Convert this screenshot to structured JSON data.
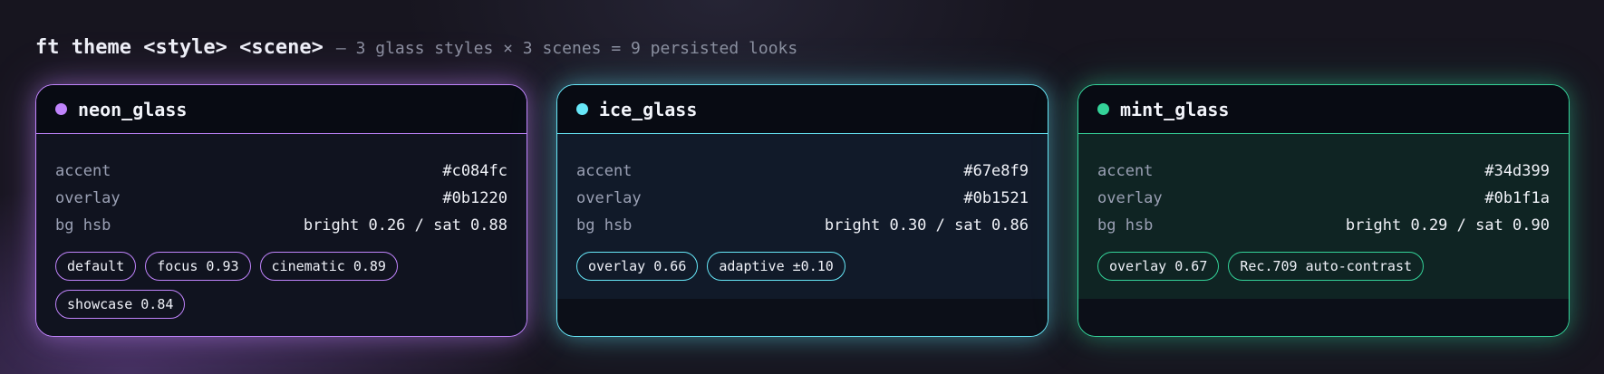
{
  "header": {
    "command": "ft theme <style> <scene>",
    "subtitle": "— 3 glass styles × 3 scenes = 9 persisted looks"
  },
  "cards": [
    {
      "name": "neon_glass",
      "color": "#c084fc",
      "rows": [
        {
          "key": "accent",
          "value": "#c084fc"
        },
        {
          "key": "overlay",
          "value": "#0b1220"
        },
        {
          "key": "bg hsb",
          "value": "bright 0.26 / sat 0.88"
        }
      ],
      "chips": [
        "default",
        "focus 0.93",
        "cinematic 0.89",
        "showcase 0.84"
      ]
    },
    {
      "name": "ice_glass",
      "color": "#67e8f9",
      "rows": [
        {
          "key": "accent",
          "value": "#67e8f9"
        },
        {
          "key": "overlay",
          "value": "#0b1521"
        },
        {
          "key": "bg hsb",
          "value": "bright 0.30 / sat 0.86"
        }
      ],
      "chips": [
        "overlay 0.66",
        "adaptive ±0.10"
      ]
    },
    {
      "name": "mint_glass",
      "color": "#34d399",
      "rows": [
        {
          "key": "accent",
          "value": "#34d399"
        },
        {
          "key": "overlay",
          "value": "#0b1f1a"
        },
        {
          "key": "bg hsb",
          "value": "bright 0.29 / sat 0.90"
        }
      ],
      "chips": [
        "overlay 0.67",
        "Rec.709 auto-contrast"
      ]
    }
  ]
}
